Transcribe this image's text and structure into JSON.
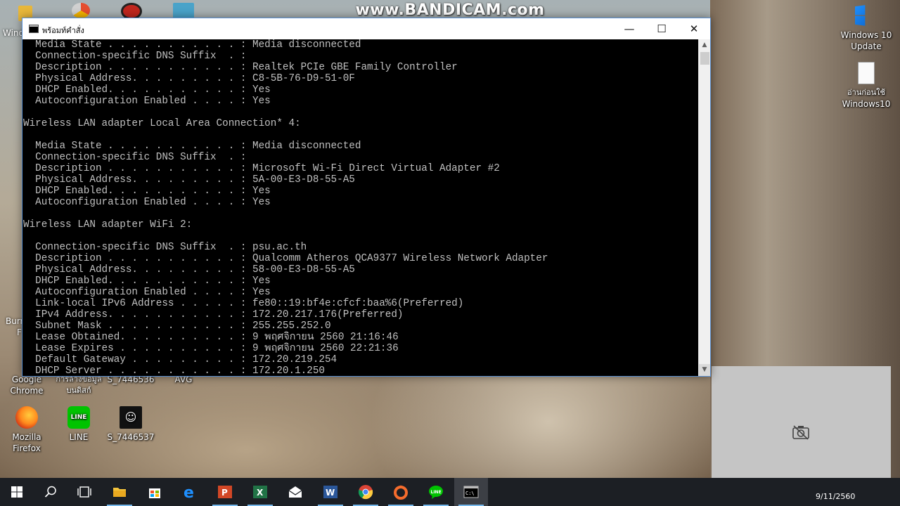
{
  "watermark": "www.BANDICAM.com",
  "desktop": {
    "icons": [
      {
        "label_1": "Google",
        "label_2": "Chrome"
      },
      {
        "label_1": "การล้างข้อมูล",
        "label_2": "บนดิสก์"
      },
      {
        "label_1": "S_7446536",
        "label_2": ""
      },
      {
        "label_1": "AVG",
        "label_2": ""
      },
      {
        "label_1": "Mozilla",
        "label_2": "Firefox"
      },
      {
        "label_1": "LINE",
        "label_2": ""
      },
      {
        "label_1": "S_7446537",
        "label_2": ""
      },
      {
        "label_1": "Windows 10",
        "label_2": "Update"
      },
      {
        "label_1": "อ่านก่อนใช้",
        "label_2": "Windows10"
      }
    ],
    "partial_labels": [
      "Wind",
      "Burn",
      "F"
    ]
  },
  "window": {
    "title": "พร้อมท์คำสั่ง",
    "buttons": {
      "minimize": "—",
      "maximize": "☐",
      "close": "✕"
    },
    "console_text": "  Media State . . . . . . . . . . . : Media disconnected\n  Connection-specific DNS Suffix  . :\n  Description . . . . . . . . . . . : Realtek PCIe GBE Family Controller\n  Physical Address. . . . . . . . . : C8-5B-76-D9-51-0F\n  DHCP Enabled. . . . . . . . . . . : Yes\n  Autoconfiguration Enabled . . . . : Yes\n\nWireless LAN adapter Local Area Connection* 4:\n\n  Media State . . . . . . . . . . . : Media disconnected\n  Connection-specific DNS Suffix  . :\n  Description . . . . . . . . . . . : Microsoft Wi-Fi Direct Virtual Adapter #2\n  Physical Address. . . . . . . . . : 5A-00-E3-D8-55-A5\n  DHCP Enabled. . . . . . . . . . . : Yes\n  Autoconfiguration Enabled . . . . : Yes\n\nWireless LAN adapter WiFi 2:\n\n  Connection-specific DNS Suffix  . : psu.ac.th\n  Description . . . . . . . . . . . : Qualcomm Atheros QCA9377 Wireless Network Adapter\n  Physical Address. . . . . . . . . : 58-00-E3-D8-55-A5\n  DHCP Enabled. . . . . . . . . . . : Yes\n  Autoconfiguration Enabled . . . . : Yes\n  Link-local IPv6 Address . . . . . : fe80::19:bf4e:cfcf:baa%6(Preferred)\n  IPv4 Address. . . . . . . . . . . : 172.20.217.176(Preferred)\n  Subnet Mask . . . . . . . . . . . : 255.255.252.0\n  Lease Obtained. . . . . . . . . . : 9 พฤศจิกายน 2560 21:16:46\n  Lease Expires . . . . . . . . . . : 9 พฤศจิกายน 2560 22:21:36\n  Default Gateway . . . . . . . . . : 172.20.219.254\n  DHCP Server . . . . . . . . . . . : 172.20.1.250"
  },
  "taskbar": {
    "items": [
      "start-icon",
      "search-icon",
      "task-view-icon",
      "file-explorer-icon",
      "store-icon",
      "edge-icon",
      "powerpoint-icon",
      "excel-icon",
      "mail-icon",
      "word-icon",
      "chrome-icon",
      "origin-icon",
      "line-icon",
      "cmd-icon"
    ],
    "colors": {
      "accent": "#76b9ed",
      "background": "#1c1f24"
    }
  },
  "clock_text": "9/11/2560"
}
